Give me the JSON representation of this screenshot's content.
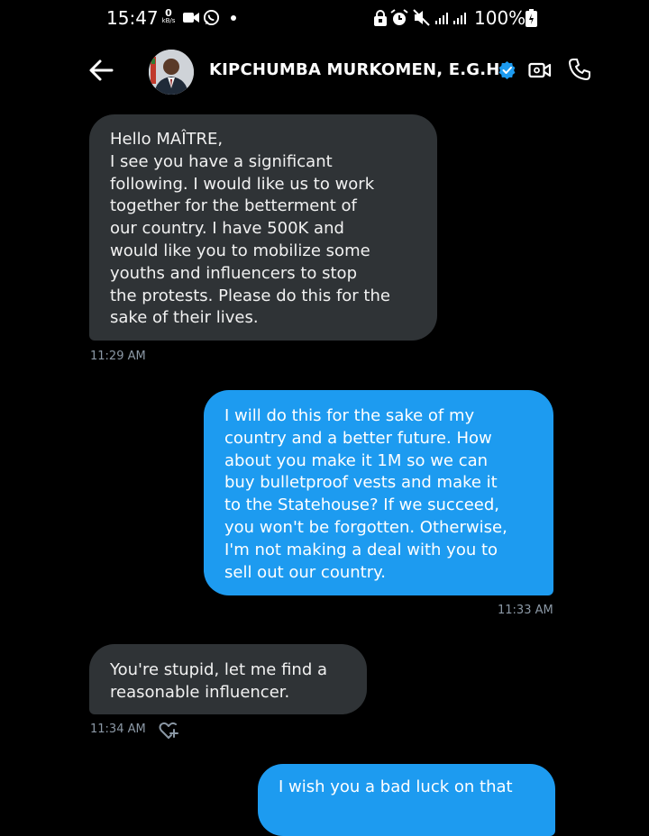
{
  "status_bar": {
    "time": "15:47",
    "net_speed_value": "0",
    "net_speed_unit": "kB/s",
    "battery_percent": "100%",
    "icons": [
      "video-recorder-icon",
      "whatsapp-icon",
      "dot-icon",
      "lock-icon",
      "alarm-icon",
      "mute-icon",
      "signal-icon",
      "signal-icon",
      "battery-icon"
    ]
  },
  "header": {
    "contact_name": "KIPCHUMBA MURKOMEN, E.G.H",
    "icons": [
      "back-arrow-icon",
      "avatar",
      "verified-badge-icon",
      "video-call-icon",
      "phone-icon"
    ]
  },
  "messages": [
    {
      "direction": "incoming",
      "text": "Hello MAÎTRE,\nI see you have a significant\nfollowing. I would like us to work\ntogether for the betterment of\nour country. I have 500K and\nwould like you to mobilize some\nyouths and influencers to stop\nthe protests. Please do this for the\nsake of their lives.",
      "time": "11:29 AM"
    },
    {
      "direction": "outgoing",
      "text": "I will do this for the sake of my\ncountry and a better future. How\nabout you make it 1M so we can\nbuy bulletproof vests and make it\nto the Statehouse? If we succeed,\nyou won't be forgotten. Otherwise,\nI'm not making a deal with you to\nsell out our country.",
      "time": "11:33 AM"
    },
    {
      "direction": "incoming",
      "text": "You're stupid, let me find a\nreasonable influencer.",
      "time": "11:34 AM"
    },
    {
      "direction": "outgoing",
      "text": "I wish you a bad luck on that",
      "time": ""
    }
  ],
  "colors": {
    "background": "#000000",
    "incoming_bubble": "#2f3336",
    "outgoing_bubble": "#1d9bf0",
    "timestamp": "#8b98a5",
    "verified": "#1d9bf0"
  }
}
